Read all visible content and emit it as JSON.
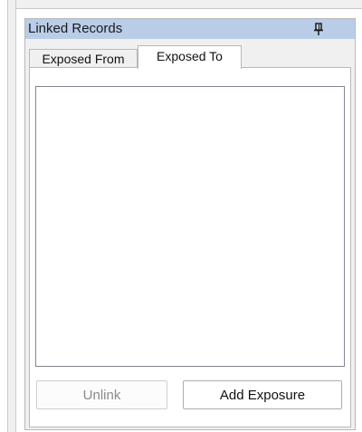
{
  "panel": {
    "title": "Linked Records",
    "pin_icon": "pin-icon"
  },
  "tabs": [
    {
      "label": "Exposed From",
      "active": false
    },
    {
      "label": "Exposed To",
      "active": true
    }
  ],
  "buttons": {
    "unlink_label": "Unlink",
    "unlink_enabled": false,
    "add_exposure_label": "Add Exposure",
    "add_exposure_enabled": true
  },
  "colors": {
    "title_bar": "#b9cde8",
    "panel_bg": "#f0f0f0",
    "disabled_text": "#8a8a8a"
  }
}
